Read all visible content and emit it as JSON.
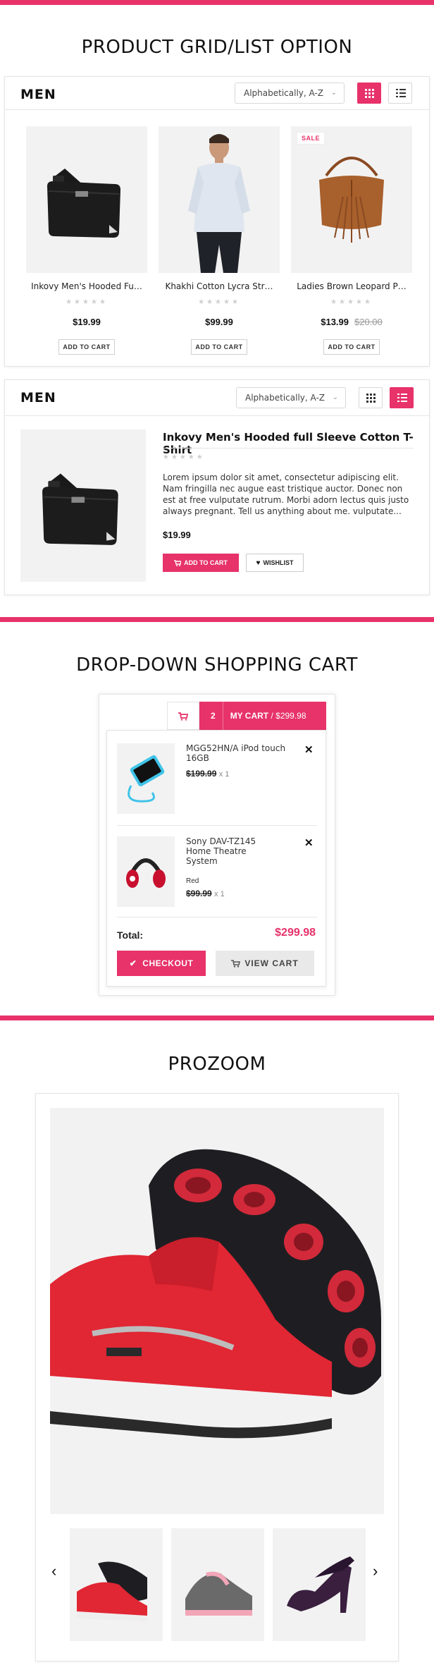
{
  "colors": {
    "accent": "#e7326a",
    "panel_bg": "#f2f2f2"
  },
  "sections": {
    "grid_title": "PRODUCT GRID/LIST OPTION",
    "cart_title": "DROP-DOWN SHOPPING CART",
    "zoom_title": "PROZOOM"
  },
  "grid_panel": {
    "heading": "MEN",
    "sort_value": "Alphabetically, A-Z",
    "products": [
      {
        "name": "Inkovy Men's Hooded Fu…",
        "price": "$19.99",
        "old_price": "",
        "button": "ADD TO CART",
        "sale": ""
      },
      {
        "name": "Khakhi Cotton Lycra Str…",
        "price": "$99.99",
        "old_price": "",
        "button": "ADD TO CART",
        "sale": ""
      },
      {
        "name": "Ladies Brown Leopard P…",
        "price": "$13.99",
        "old_price": "$20.00",
        "button": "ADD TO CART",
        "sale": "SALE"
      }
    ],
    "stars": "★★★★★"
  },
  "list_panel": {
    "heading": "MEN",
    "sort_value": "Alphabetically, A-Z",
    "product": {
      "name": "Inkovy Men's Hooded full Sleeve Cotton T-Shirt",
      "stars": "★★★★★",
      "description": "Lorem ipsum dolor sit amet, consectetur adipiscing elit. Nam fringilla nec augue east tristique auctor. Donec non est at free vulputate rutrum. Morbi adorn lectus quis justo always pregnant. Tell us anything about me. vulputate...",
      "price": "$19.99",
      "add_to_cart": "ADD TO CART",
      "wishlist": "WISHLIST"
    }
  },
  "cart": {
    "count": "2",
    "label": "MY CART",
    "total_header": "/ $299.98",
    "items": [
      {
        "name": "MGG52HN/A iPod touch 16GB",
        "variant": "",
        "price": "$199.99",
        "qty": "x 1"
      },
      {
        "name": "Sony DAV-TZ145 Home Theatre System",
        "variant": "Red",
        "price": "$99.99",
        "qty": "x 1"
      }
    ],
    "total_label": "Total:",
    "total_value": "$299.98",
    "checkout": "CHECKOUT",
    "view_cart": "VIEW CART"
  },
  "zoom": {
    "prev_icon": "chevron-left-icon",
    "next_icon": "chevron-right-icon",
    "thumbs": [
      "red-sneaker",
      "grey-pink-sneaker",
      "purple-heel"
    ]
  }
}
